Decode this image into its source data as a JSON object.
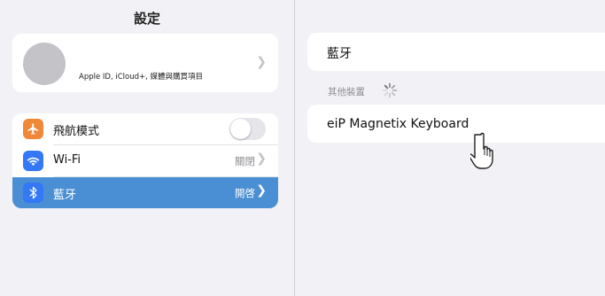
{
  "left": {
    "title": "設定",
    "profile": {
      "subtitle": "Apple ID, iCloud+, 媒體與購買項目"
    },
    "items": [
      {
        "label": "飛航模式",
        "icon": "airplane-icon",
        "color": "#f0883a",
        "toggle": false
      },
      {
        "label": "Wi-Fi",
        "icon": "wifi-icon",
        "color": "#3478f6",
        "value": "關閉"
      },
      {
        "label": "藍牙",
        "icon": "bluetooth-icon",
        "color": "#3478f6",
        "value": "開啓",
        "selected": true
      }
    ]
  },
  "right": {
    "bluetooth_label": "藍牙",
    "section_header": "其他裝置",
    "device_name": "eiP Magnetix Keyboard"
  },
  "colors": {
    "selected_row": "#4a8fd4",
    "background": "#f2f2f6"
  }
}
